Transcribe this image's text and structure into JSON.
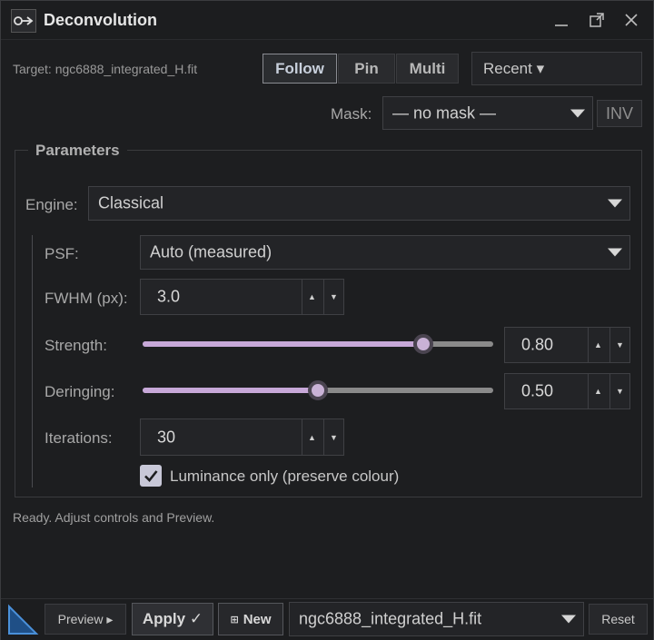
{
  "window": {
    "title": "Deconvolution"
  },
  "target": {
    "label": "Target: ngc6888_integrated_H.fit"
  },
  "mode_buttons": [
    {
      "label": "Follow",
      "active": true
    },
    {
      "label": "Pin",
      "active": false
    },
    {
      "label": "Multi",
      "active": false
    }
  ],
  "recent": {
    "label": "Recent ▾"
  },
  "mask": {
    "label": "Mask:",
    "value": "— no mask —",
    "inv_label": "INV"
  },
  "parameters": {
    "title": "Parameters",
    "engine": {
      "label": "Engine:",
      "value": "Classical"
    },
    "psf": {
      "label": "PSF:",
      "value": "Auto (measured)"
    },
    "fwhm": {
      "label": "FWHM (px):",
      "value": "3.0"
    },
    "strength": {
      "label": "Strength:",
      "value": "0.80",
      "fraction": 0.8
    },
    "deringing": {
      "label": "Deringing:",
      "value": "0.50",
      "fraction": 0.5
    },
    "iterations": {
      "label": "Iterations:",
      "value": "30"
    },
    "luminance": {
      "label": "Luminance only (preserve colour)",
      "checked": true
    }
  },
  "status": {
    "text": "Ready. Adjust controls and Preview."
  },
  "bottom": {
    "preview_label": "Preview ▸",
    "apply_label": "Apply ✓",
    "new_label": "New",
    "new_icon": "⊞",
    "file_value": "ngc6888_integrated_H.fit",
    "reset_label": "Reset"
  },
  "colors": {
    "accent": "#c7a8d8",
    "background": "#1d1e20",
    "logo_blue": "#2a6fb8"
  }
}
